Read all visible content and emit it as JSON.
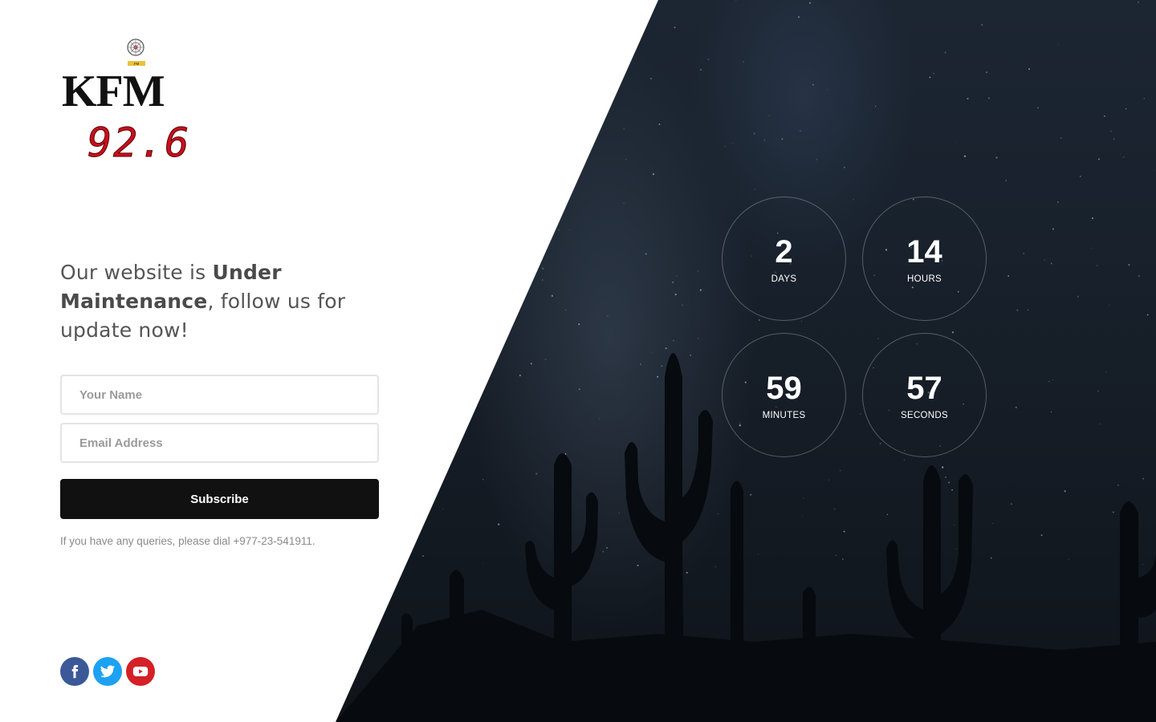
{
  "brand": {
    "name": "KFM",
    "frequency": "92.6",
    "badge_text": "FM"
  },
  "headline": {
    "part1": "Our website is ",
    "bold1": "Under Maintenance",
    "part2": ", follow us for update now!"
  },
  "form": {
    "name_placeholder": "Your Name",
    "email_placeholder": "Email Address",
    "subscribe_label": "Subscribe"
  },
  "note": "If you have any queries, please dial +977-23-541911.",
  "countdown": {
    "days": {
      "value": "2",
      "label": "DAYS"
    },
    "hours": {
      "value": "14",
      "label": "HOURS"
    },
    "minutes": {
      "value": "59",
      "label": "MINUTES"
    },
    "seconds": {
      "value": "57",
      "label": "SECONDS"
    }
  },
  "social": [
    {
      "name": "facebook",
      "icon": "facebook-icon",
      "color": "#3b5998"
    },
    {
      "name": "twitter",
      "icon": "twitter-icon",
      "color": "#1da1f2"
    },
    {
      "name": "youtube",
      "icon": "youtube-icon",
      "color": "#d42027"
    }
  ],
  "colors": {
    "button_bg": "#111111",
    "sky_dark": "#151c25",
    "frequency_red": "#c8101c"
  }
}
